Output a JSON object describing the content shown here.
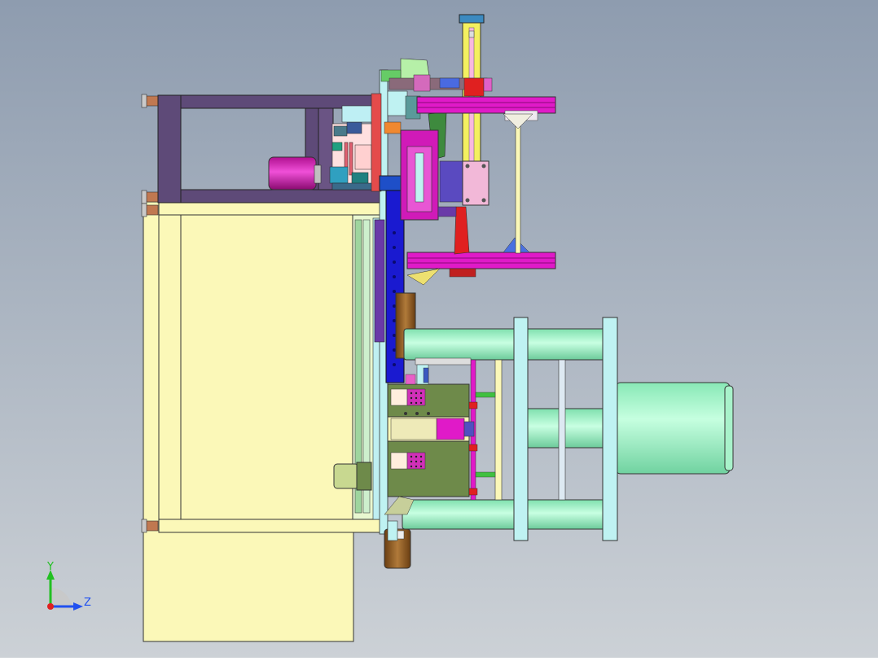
{
  "viewport": {
    "background_top": "#8E9CAF",
    "background_bottom": "#CCD1D6"
  },
  "colors": {
    "cream": "#FBF8B8",
    "purple_frame": "#5E4A78",
    "magenta": "#E01AC8",
    "blue_column": "#1A1AD0",
    "green_cylinder": "#9AF5C4",
    "olive_block": "#6E8A4A",
    "bronze": "#8A5A22",
    "light_cyan": "#BFF2F2",
    "yellow_rod": "#F4F060",
    "red_part": "#E02020",
    "pink_plate": "#F2B8D8"
  },
  "triad": {
    "y_label": "Y",
    "z_label": "Z",
    "y_color": "#22C022",
    "z_color": "#2050F0",
    "origin_color": "#E02020"
  }
}
